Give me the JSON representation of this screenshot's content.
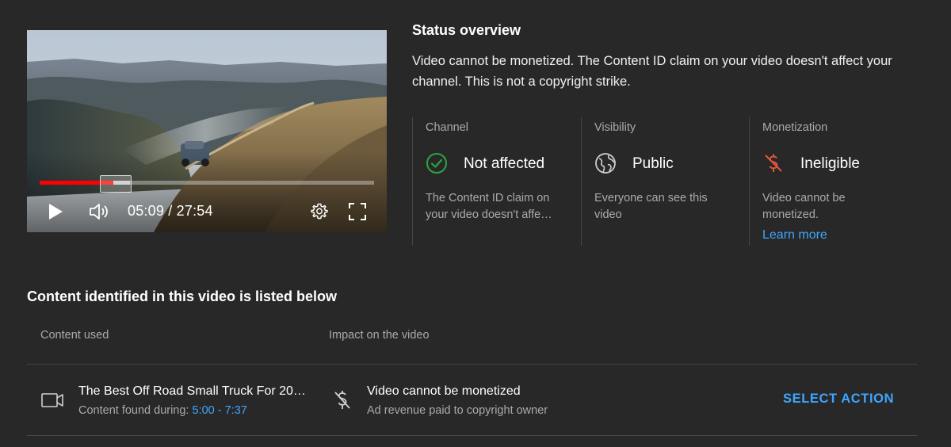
{
  "player": {
    "time": "05:09 / 27:54",
    "progress_played_fraction": 0.22,
    "progress_buffered_fraction": 0.05,
    "icons": [
      "play-icon",
      "volume-icon",
      "settings-gear-icon",
      "fullscreen-icon"
    ]
  },
  "status": {
    "title": "Status overview",
    "description": "Video cannot be monetized. The Content ID claim on your video doesn't affect your channel. This is not a copyright strike.",
    "channel": {
      "label": "Channel",
      "value": "Not affected",
      "desc": "The Content ID claim on your video doesn't affe…",
      "desc_line1": "The Content ID claim on",
      "desc_line2": "your video doesn't affe…",
      "icon": "check-circle-icon",
      "icon_color": "#2ba640"
    },
    "visibility": {
      "label": "Visibility",
      "value": "Public",
      "desc": "Everyone can see this video",
      "icon": "globe-icon"
    },
    "monetization": {
      "label": "Monetization",
      "value": "Ineligible",
      "desc": "Video cannot be monetized.",
      "learn_more": "Learn more",
      "icon": "dollar-off-icon",
      "icon_color": "#e5533d"
    }
  },
  "content": {
    "section_title": "Content identified in this video is listed below",
    "columns": [
      "Content used",
      "Impact on the video"
    ],
    "rows": [
      {
        "title": "The Best Off Road Small Truck For 20…",
        "found_label": "Content found during:",
        "found_range": "5:00 - 7:37",
        "impact_title": "Video cannot be monetized",
        "impact_sub": "Ad revenue paid to copyright owner",
        "action": "SELECT ACTION"
      }
    ]
  },
  "colors": {
    "background": "#282828",
    "accent_link": "#3ea6ff",
    "progress_red": "#ff0000"
  }
}
